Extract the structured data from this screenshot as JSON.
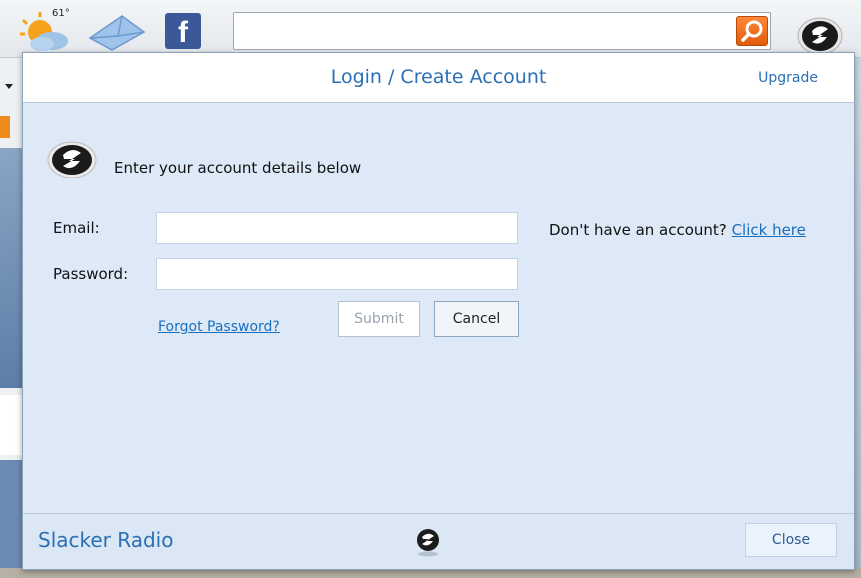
{
  "toolbar": {
    "weather_temp": "61°",
    "weather_icon": "partly-cloudy-icon",
    "mail_icon": "envelope-icon",
    "facebook_icon": "facebook-icon",
    "facebook_glyph": "f",
    "search_value": "",
    "search_icon": "magnifier-icon",
    "slacker_icon": "slacker-logo-icon"
  },
  "popup": {
    "title": "Login / Create Account",
    "upgrade_label": "Upgrade",
    "intro": "Enter your account details below",
    "email_label": "Email:",
    "email_value": "",
    "password_label": "Password:",
    "password_value": "",
    "no_account_text": "Don't have an account?",
    "click_here_label": "Click here",
    "forgot_password_label": "Forgot Password?",
    "submit_label": "Submit",
    "cancel_label": "Cancel"
  },
  "footer": {
    "brand": "Slacker Radio",
    "close_label": "Close"
  },
  "colors": {
    "accent": "#2b6fb6",
    "link": "#1a6fc0",
    "popup_bg": "#dde9f7",
    "facebook": "#3b5998",
    "search_button": "#e86a16"
  }
}
